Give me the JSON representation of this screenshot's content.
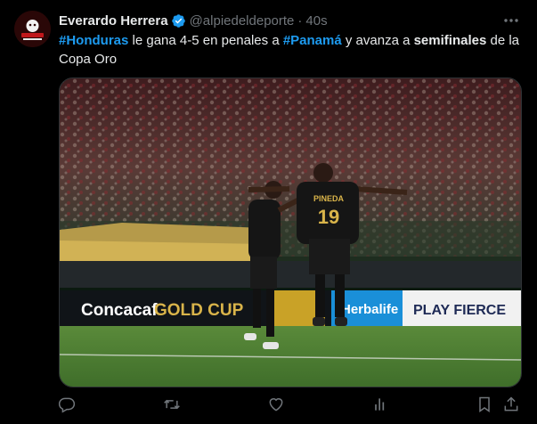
{
  "author": {
    "name": "Everardo Herrera",
    "handle": "@alpiedeldeporte",
    "separator": "·",
    "time": "40s",
    "verified_color": "#1d9bf0",
    "avatar_logo_text": "AL PIE DEL DEPORTE"
  },
  "tweet": {
    "part1": "#Honduras",
    "part2": " le gana 4-5 en penales a ",
    "part3": "#Panamá",
    "part4": " y avanza a ",
    "part5": "semifinales",
    "part6": " de la Copa Oro"
  },
  "media": {
    "board_concacaf": "Concacaf",
    "board_goldcup": "GOLD CUP",
    "board_herbalife": "Herbalife",
    "board_playfierce": "PLAY FIERCE",
    "jersey_number": "19",
    "jersey_name": "PINEDA",
    "accent_gold": "#c9a227",
    "jersey_color": "#151515"
  },
  "actions": {
    "icons": [
      "reply-icon",
      "retweet-icon",
      "like-icon",
      "views-icon",
      "bookmark-icon",
      "share-icon"
    ]
  },
  "colors": {
    "background": "#000000",
    "text": "#e7e9ea",
    "secondary": "#71767b",
    "link": "#1d9bf0"
  }
}
